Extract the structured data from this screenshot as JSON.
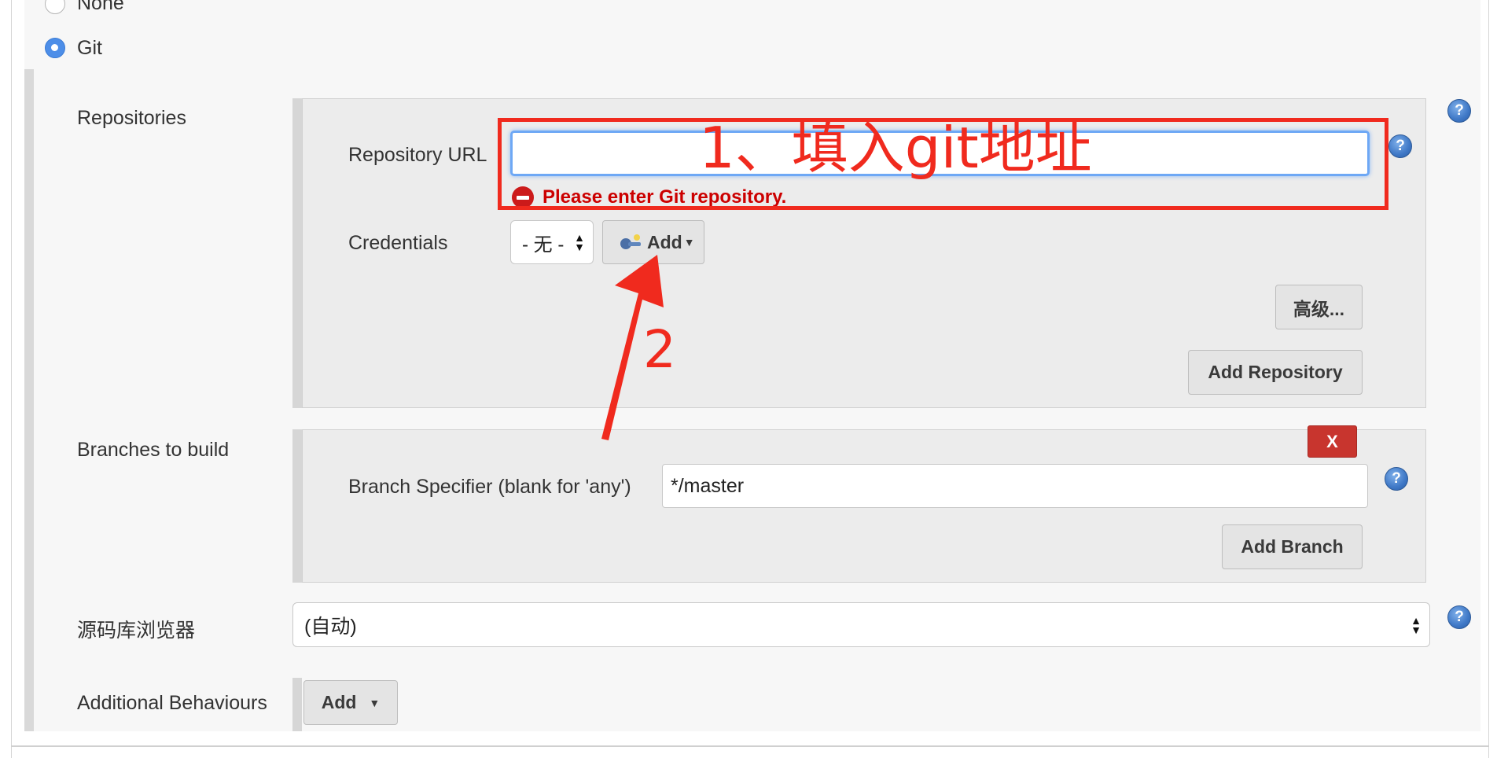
{
  "scm": {
    "options": [
      {
        "label": "None",
        "checked": false
      },
      {
        "label": "Git",
        "checked": true
      }
    ]
  },
  "repositories": {
    "section_label": "Repositories",
    "url_label": "Repository URL",
    "url_value": "",
    "error_message": "Please enter Git repository.",
    "credentials_label": "Credentials",
    "credentials_selected": "- 无 -",
    "add_credentials_label": "Add",
    "advanced_button": "高级...",
    "add_repository_button": "Add Repository"
  },
  "branches": {
    "section_label": "Branches to build",
    "delete_button": "X",
    "specifier_label": "Branch Specifier (blank for 'any')",
    "specifier_value": "*/master",
    "add_branch_button": "Add Branch"
  },
  "browser": {
    "label": "源码库浏览器",
    "selected": "(自动)"
  },
  "behaviours": {
    "label": "Additional Behaviours",
    "add_button": "Add"
  },
  "help_icon_glyph": "?",
  "annotations": {
    "step1": "1、填入git地址",
    "step2": "2",
    "color": "#f02a1e"
  },
  "colors": {
    "error": "#cc0000",
    "delete_button": "#c8352e",
    "focus": "#6ea8f5"
  }
}
